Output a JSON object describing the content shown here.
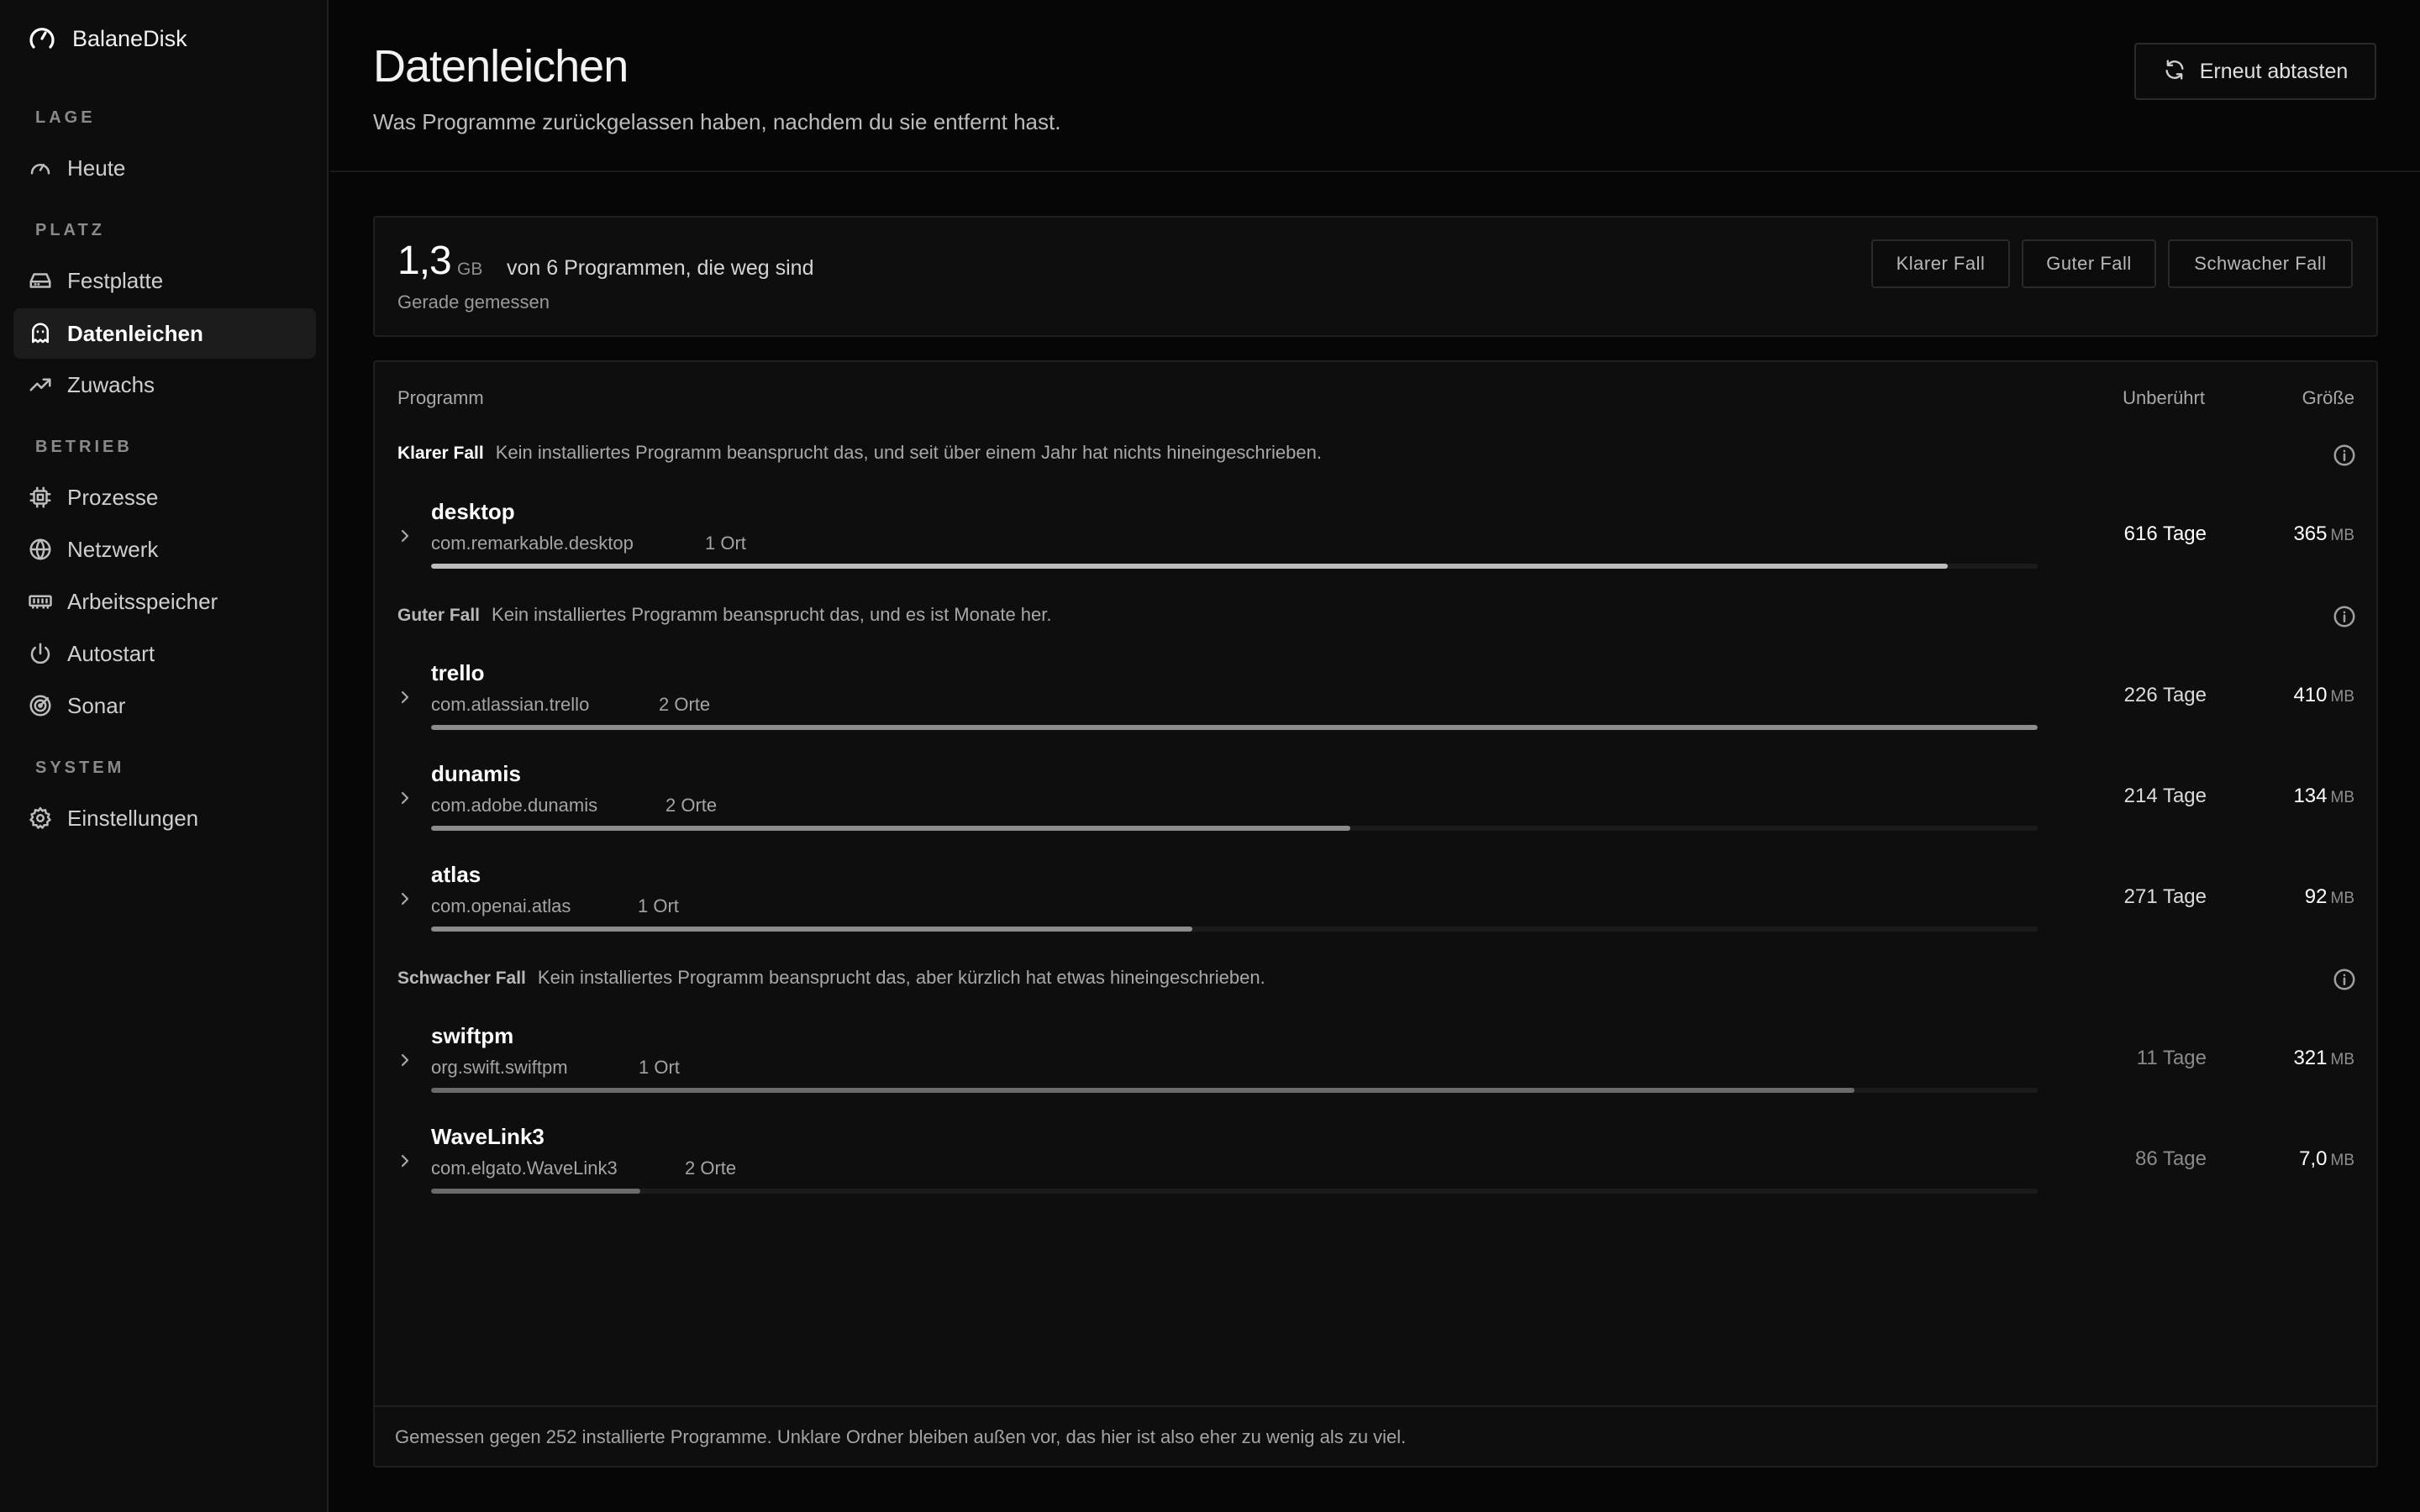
{
  "app": {
    "name": "BalaneDisk"
  },
  "sidebar": {
    "sections": {
      "lage": "LAGE",
      "platz": "PLATZ",
      "betrieb": "BETRIEB",
      "system": "SYSTEM"
    },
    "items": [
      {
        "label": "Heute",
        "icon": "gauge-icon"
      },
      {
        "label": "Festplatte",
        "icon": "hard-drive-icon"
      },
      {
        "label": "Datenleichen",
        "icon": "ghost-icon",
        "active": true
      },
      {
        "label": "Zuwachs",
        "icon": "trending-up-icon"
      },
      {
        "label": "Prozesse",
        "icon": "cpu-icon"
      },
      {
        "label": "Netzwerk",
        "icon": "globe-icon"
      },
      {
        "label": "Arbeitsspeicher",
        "icon": "memory-icon"
      },
      {
        "label": "Autostart",
        "icon": "power-icon"
      },
      {
        "label": "Sonar",
        "icon": "radar-icon"
      },
      {
        "label": "Einstellungen",
        "icon": "gear-icon"
      }
    ]
  },
  "header": {
    "title": "Datenleichen",
    "subtitle": "Was Programme zurückgelassen haben, nachdem du sie entfernt hast.",
    "rescan_label": "Erneut abtasten"
  },
  "summary": {
    "total": "1,3",
    "unit": "GB",
    "description": "von 6 Programmen, die weg sind",
    "meta": "Gerade gemessen",
    "filters": [
      "Klarer Fall",
      "Guter Fall",
      "Schwacher Fall"
    ]
  },
  "table": {
    "columns": {
      "program": "Programm",
      "untouched": "Unberührt",
      "size": "Größe"
    },
    "groups": [
      {
        "name": "Klarer Fall",
        "description": "Kein installiertes Programm beansprucht das, und seit über einem Jahr hat nichts hineingeschrieben.",
        "rows": [
          {
            "name": "desktop",
            "id": "com.remarkable.desktop",
            "locations": "1 Ort",
            "age": "616 Tage",
            "size": "365",
            "size_unit": "MB",
            "bar_fraction": 0.944,
            "bar_color": "#bdbdbd"
          }
        ]
      },
      {
        "name": "Guter Fall",
        "description": "Kein installiertes Programm beansprucht das, und es ist Monate her.",
        "rows": [
          {
            "name": "trello",
            "id": "com.atlassian.trello",
            "locations": "2 Orte",
            "age": "226 Tage",
            "size": "410",
            "size_unit": "MB",
            "bar_fraction": 1.0,
            "bar_color": "#8c8c8c"
          },
          {
            "name": "dunamis",
            "id": "com.adobe.dunamis",
            "locations": "2 Orte",
            "age": "214 Tage",
            "size": "134",
            "size_unit": "MB",
            "bar_fraction": 0.572,
            "bar_color": "#8c8c8c"
          },
          {
            "name": "atlas",
            "id": "com.openai.atlas",
            "locations": "1 Ort",
            "age": "271 Tage",
            "size": "92",
            "size_unit": "MB",
            "bar_fraction": 0.474,
            "bar_color": "#8c8c8c"
          }
        ]
      },
      {
        "name": "Schwacher Fall",
        "description": "Kein installiertes Programm beansprucht das, aber kürzlich hat etwas hineingeschrieben.",
        "rows": [
          {
            "name": "swiftpm",
            "id": "org.swift.swiftpm",
            "locations": "1 Ort",
            "age": "11 Tage",
            "size": "321",
            "size_unit": "MB",
            "bar_fraction": 0.886,
            "bar_color": "#6a6a6a"
          },
          {
            "name": "WaveLink3",
            "id": "com.elgato.WaveLink3",
            "locations": "2 Orte",
            "age": "86 Tage",
            "size": "7,0",
            "size_unit": "MB",
            "bar_fraction": 0.13,
            "bar_color": "#6a6a6a"
          }
        ]
      }
    ],
    "footer": "Gemessen gegen 252 installierte Programme. Unklare Ordner bleiben außen vor, das hier ist also eher zu wenig als zu viel."
  }
}
